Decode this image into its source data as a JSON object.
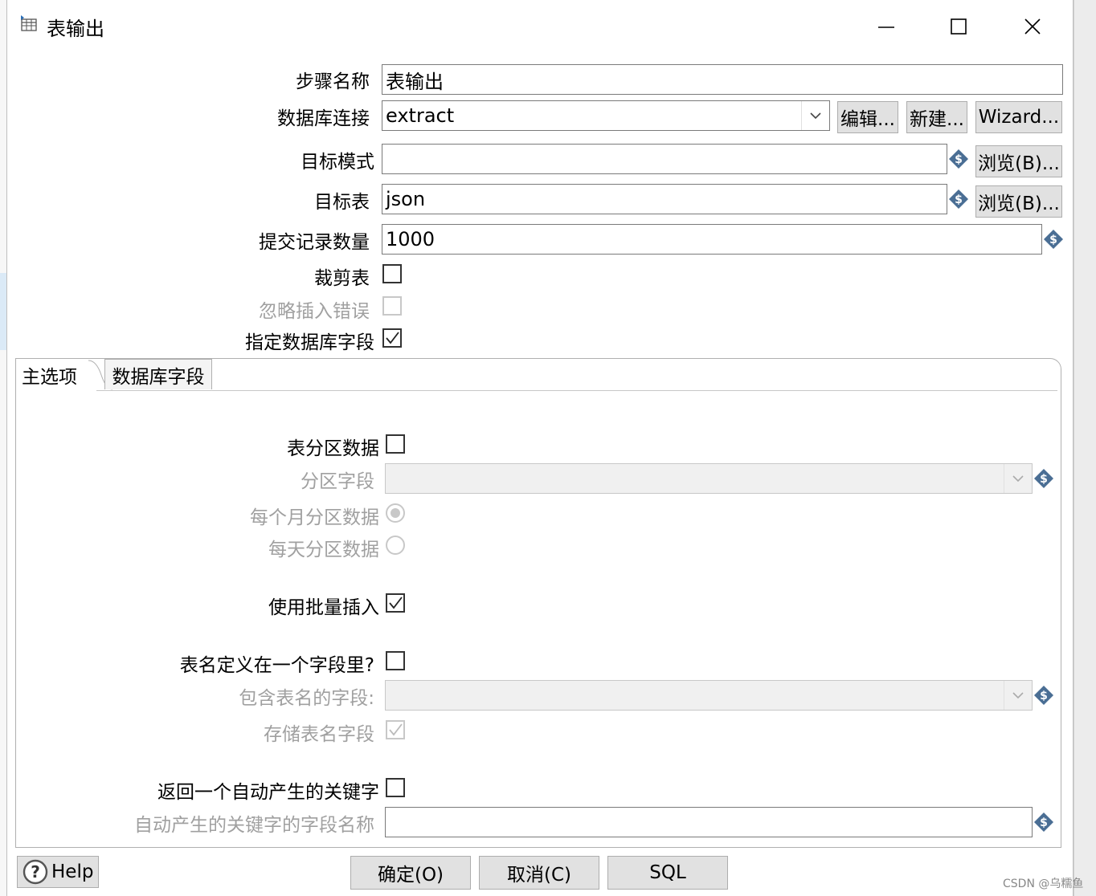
{
  "dialog": {
    "title": "表输出",
    "window_controls": [
      "minimize-icon",
      "maximize-icon",
      "close-icon"
    ]
  },
  "form": {
    "step_name_label": "步骤名称",
    "step_name_value": "表输出",
    "db_conn_label": "数据库连接",
    "db_conn_value": "extract",
    "edit_label": "编辑...",
    "new_label": "新建...",
    "wizard_label": "Wizard...",
    "target_schema_label": "目标模式",
    "target_schema_value": "",
    "browse_label": "浏览(B)...",
    "target_table_label": "目标表",
    "target_table_value": "json",
    "commit_size_label": "提交记录数量",
    "commit_size_value": "1000",
    "truncate_label": "裁剪表",
    "truncate_checked": false,
    "ignore_errors_label": "忽略插入错误",
    "ignore_errors_checked": false,
    "specify_fields_label": "指定数据库字段",
    "specify_fields_checked": true
  },
  "tabs": [
    {
      "label": "主选项",
      "active": true
    },
    {
      "label": "数据库字段",
      "active": false
    }
  ],
  "main_tab": {
    "partition_label": "表分区数据",
    "partition_checked": false,
    "partition_field_label": "分区字段",
    "partition_field_value": "",
    "monthly_label": "每个月分区数据",
    "monthly_selected": true,
    "daily_label": "每天分区数据",
    "daily_selected": false,
    "batch_label": "使用批量插入",
    "batch_checked": true,
    "table_in_field_label": "表名定义在一个字段里?",
    "table_in_field_checked": false,
    "table_name_field_label": "包含表名的字段:",
    "table_name_field_value": "",
    "store_table_name_label": "存储表名字段",
    "store_table_name_checked": true,
    "return_key_label": "返回一个自动产生的关键字",
    "return_key_checked": false,
    "key_field_label": "自动产生的关键字的字段名称",
    "key_field_value": ""
  },
  "footer": {
    "help_label": "Help",
    "ok_label": "确定(O)",
    "cancel_label": "取消(C)",
    "sql_label": "SQL"
  },
  "watermark": "CSDN @乌糯鱼",
  "colors": {
    "dialog_bg": "#ffffff",
    "button_bg": "#e1e1e1",
    "disabled_text": "#a0a0a0",
    "variable_icon": "#4a6e94"
  }
}
